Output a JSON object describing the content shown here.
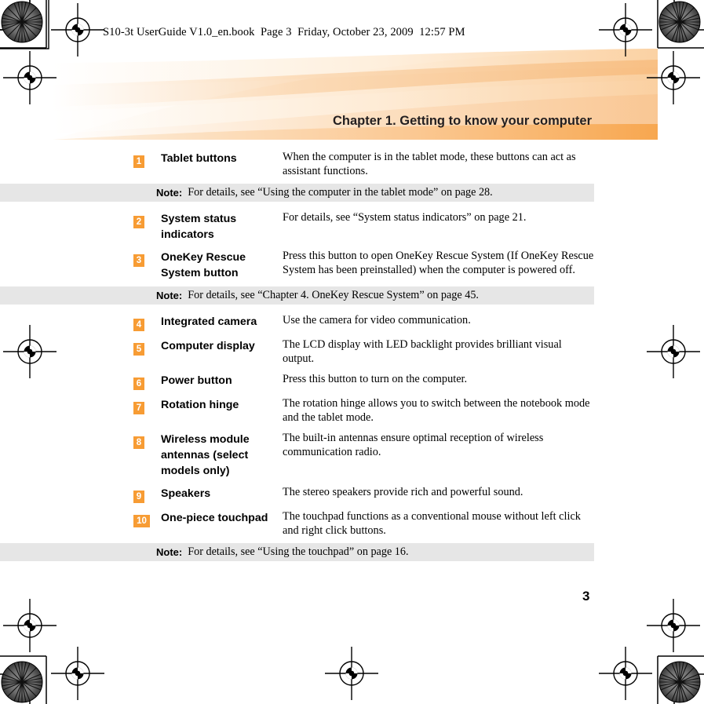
{
  "header": {
    "file_line": "S10-3t UserGuide V1.0_en.book  Page 3  Friday, October 23, 2009  12:57 PM"
  },
  "banner": {
    "chapter_title": "Chapter 1. Getting to know your computer",
    "accent_color": "#f9c794",
    "band_color": "#f9a94f"
  },
  "colors": {
    "badge_orange": "#f79c34",
    "note_background": "#e6e6e6",
    "text": "#000000"
  },
  "items": [
    {
      "number": "1",
      "label": "Tablet buttons",
      "description": "When the computer is in the tablet mode, these buttons can act as assistant functions."
    },
    {
      "number": "2",
      "label": "System status indicators",
      "description": "For details, see “System status indicators” on page 21."
    },
    {
      "number": "3",
      "label": "OneKey Rescue System button",
      "description": "Press this button to open OneKey Rescue System (If OneKey Rescue System has been preinstalled) when the computer is powered off."
    },
    {
      "number": "4",
      "label": "Integrated camera",
      "description": "Use the camera for video communication."
    },
    {
      "number": "5",
      "label": "Computer display",
      "description": "The LCD display with LED backlight provides brilliant visual output."
    },
    {
      "number": "6",
      "label": "Power button",
      "description": "Press this button to turn on the computer."
    },
    {
      "number": "7",
      "label": "Rotation hinge",
      "description": "The rotation hinge allows you to switch between the notebook mode and the tablet mode."
    },
    {
      "number": "8",
      "label": "Wireless module antennas (select models only)",
      "description": "The built-in antennas ensure optimal reception of wireless communication radio."
    },
    {
      "number": "9",
      "label": "Speakers",
      "description": "The stereo speakers provide rich and powerful sound."
    },
    {
      "number": "10",
      "label": "One-piece touchpad",
      "description": "The touchpad functions as a conventional mouse without left click and right click buttons."
    }
  ],
  "notes": [
    {
      "label": "Note:",
      "text": "For details, see “Using the computer in the tablet mode” on page 28."
    },
    {
      "label": "Note:",
      "text": "For details, see “Chapter 4. OneKey Rescue System” on page 45."
    },
    {
      "label": "Note:",
      "text": "For details, see “Using the touchpad” on page 16."
    }
  ],
  "footer": {
    "page_number": "3"
  }
}
